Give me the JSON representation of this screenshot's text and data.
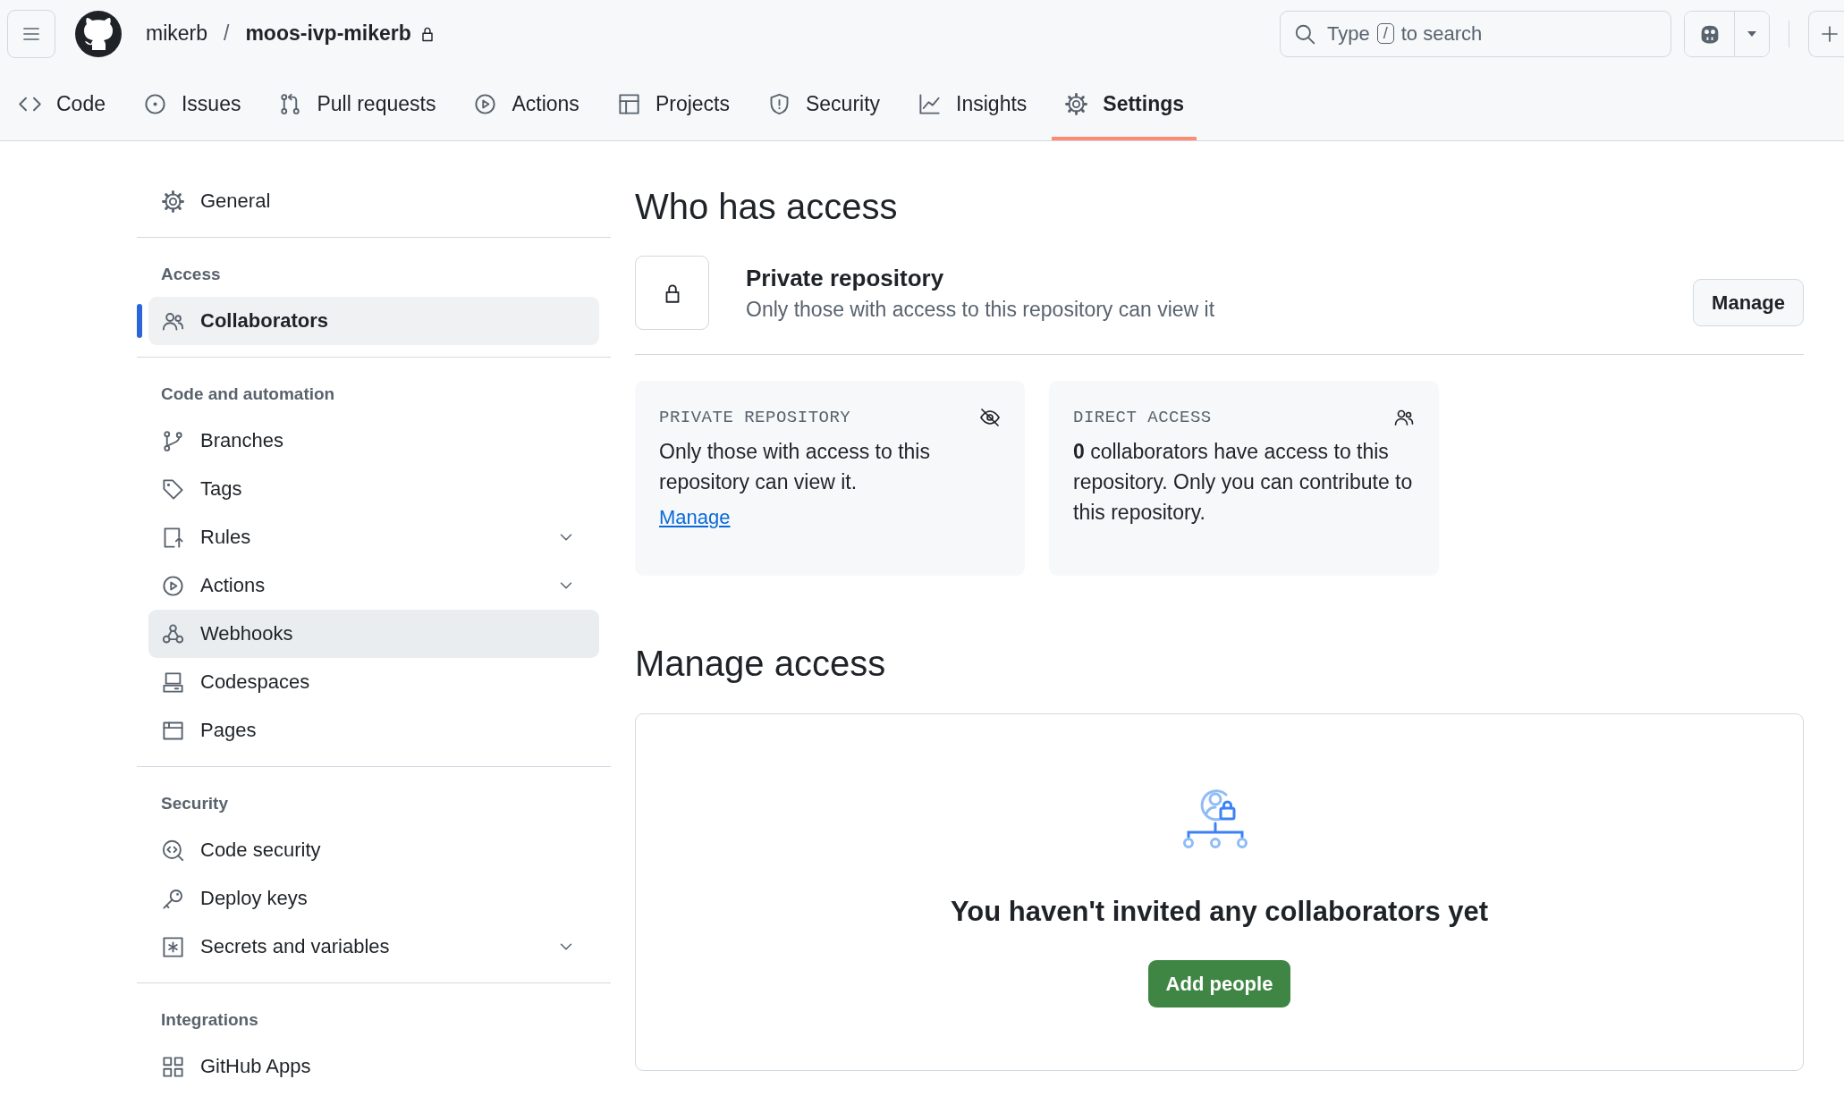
{
  "header": {
    "owner": "mikerb",
    "separator": "/",
    "repo": "moos-ivp-mikerb",
    "search": {
      "prefix": "Type",
      "key": "/",
      "suffix": "to search"
    }
  },
  "tabs": [
    {
      "label": "Code",
      "selected": false
    },
    {
      "label": "Issues",
      "selected": false
    },
    {
      "label": "Pull requests",
      "selected": false
    },
    {
      "label": "Actions",
      "selected": false
    },
    {
      "label": "Projects",
      "selected": false
    },
    {
      "label": "Security",
      "selected": false
    },
    {
      "label": "Insights",
      "selected": false
    },
    {
      "label": "Settings",
      "selected": true
    }
  ],
  "sidebar": {
    "sections": [
      {
        "items": [
          {
            "label": "General",
            "selected": false,
            "hovered": false,
            "expandable": false
          }
        ]
      },
      {
        "heading": "Access",
        "items": [
          {
            "label": "Collaborators",
            "selected": true,
            "hovered": false,
            "expandable": false
          }
        ]
      },
      {
        "heading": "Code and automation",
        "items": [
          {
            "label": "Branches",
            "selected": false,
            "hovered": false,
            "expandable": false
          },
          {
            "label": "Tags",
            "selected": false,
            "hovered": false,
            "expandable": false
          },
          {
            "label": "Rules",
            "selected": false,
            "hovered": false,
            "expandable": true
          },
          {
            "label": "Actions",
            "selected": false,
            "hovered": false,
            "expandable": true
          },
          {
            "label": "Webhooks",
            "selected": false,
            "hovered": true,
            "expandable": false
          },
          {
            "label": "Codespaces",
            "selected": false,
            "hovered": false,
            "expandable": false
          },
          {
            "label": "Pages",
            "selected": false,
            "hovered": false,
            "expandable": false
          }
        ]
      },
      {
        "heading": "Security",
        "items": [
          {
            "label": "Code security",
            "selected": false,
            "hovered": false,
            "expandable": false
          },
          {
            "label": "Deploy keys",
            "selected": false,
            "hovered": false,
            "expandable": false
          },
          {
            "label": "Secrets and variables",
            "selected": false,
            "hovered": false,
            "expandable": true
          }
        ]
      },
      {
        "heading": "Integrations",
        "items": [
          {
            "label": "GitHub Apps",
            "selected": false,
            "hovered": false,
            "expandable": false
          }
        ]
      }
    ]
  },
  "who_has_access": {
    "title": "Who has access",
    "visibility": {
      "title": "Private repository",
      "description": "Only those with access to this repository can view it",
      "button": "Manage"
    },
    "cards": [
      {
        "heading": "PRIVATE REPOSITORY",
        "text": "Only those with access to this repository can view it.",
        "link": "Manage"
      },
      {
        "heading": "DIRECT ACCESS",
        "text": "**0** collaborators have access to this repository. Only you can contribute to this repository."
      }
    ]
  },
  "manage_access": {
    "title": "Manage access",
    "empty_title": "You haven't invited any collaborators yet",
    "button": "Add people"
  }
}
